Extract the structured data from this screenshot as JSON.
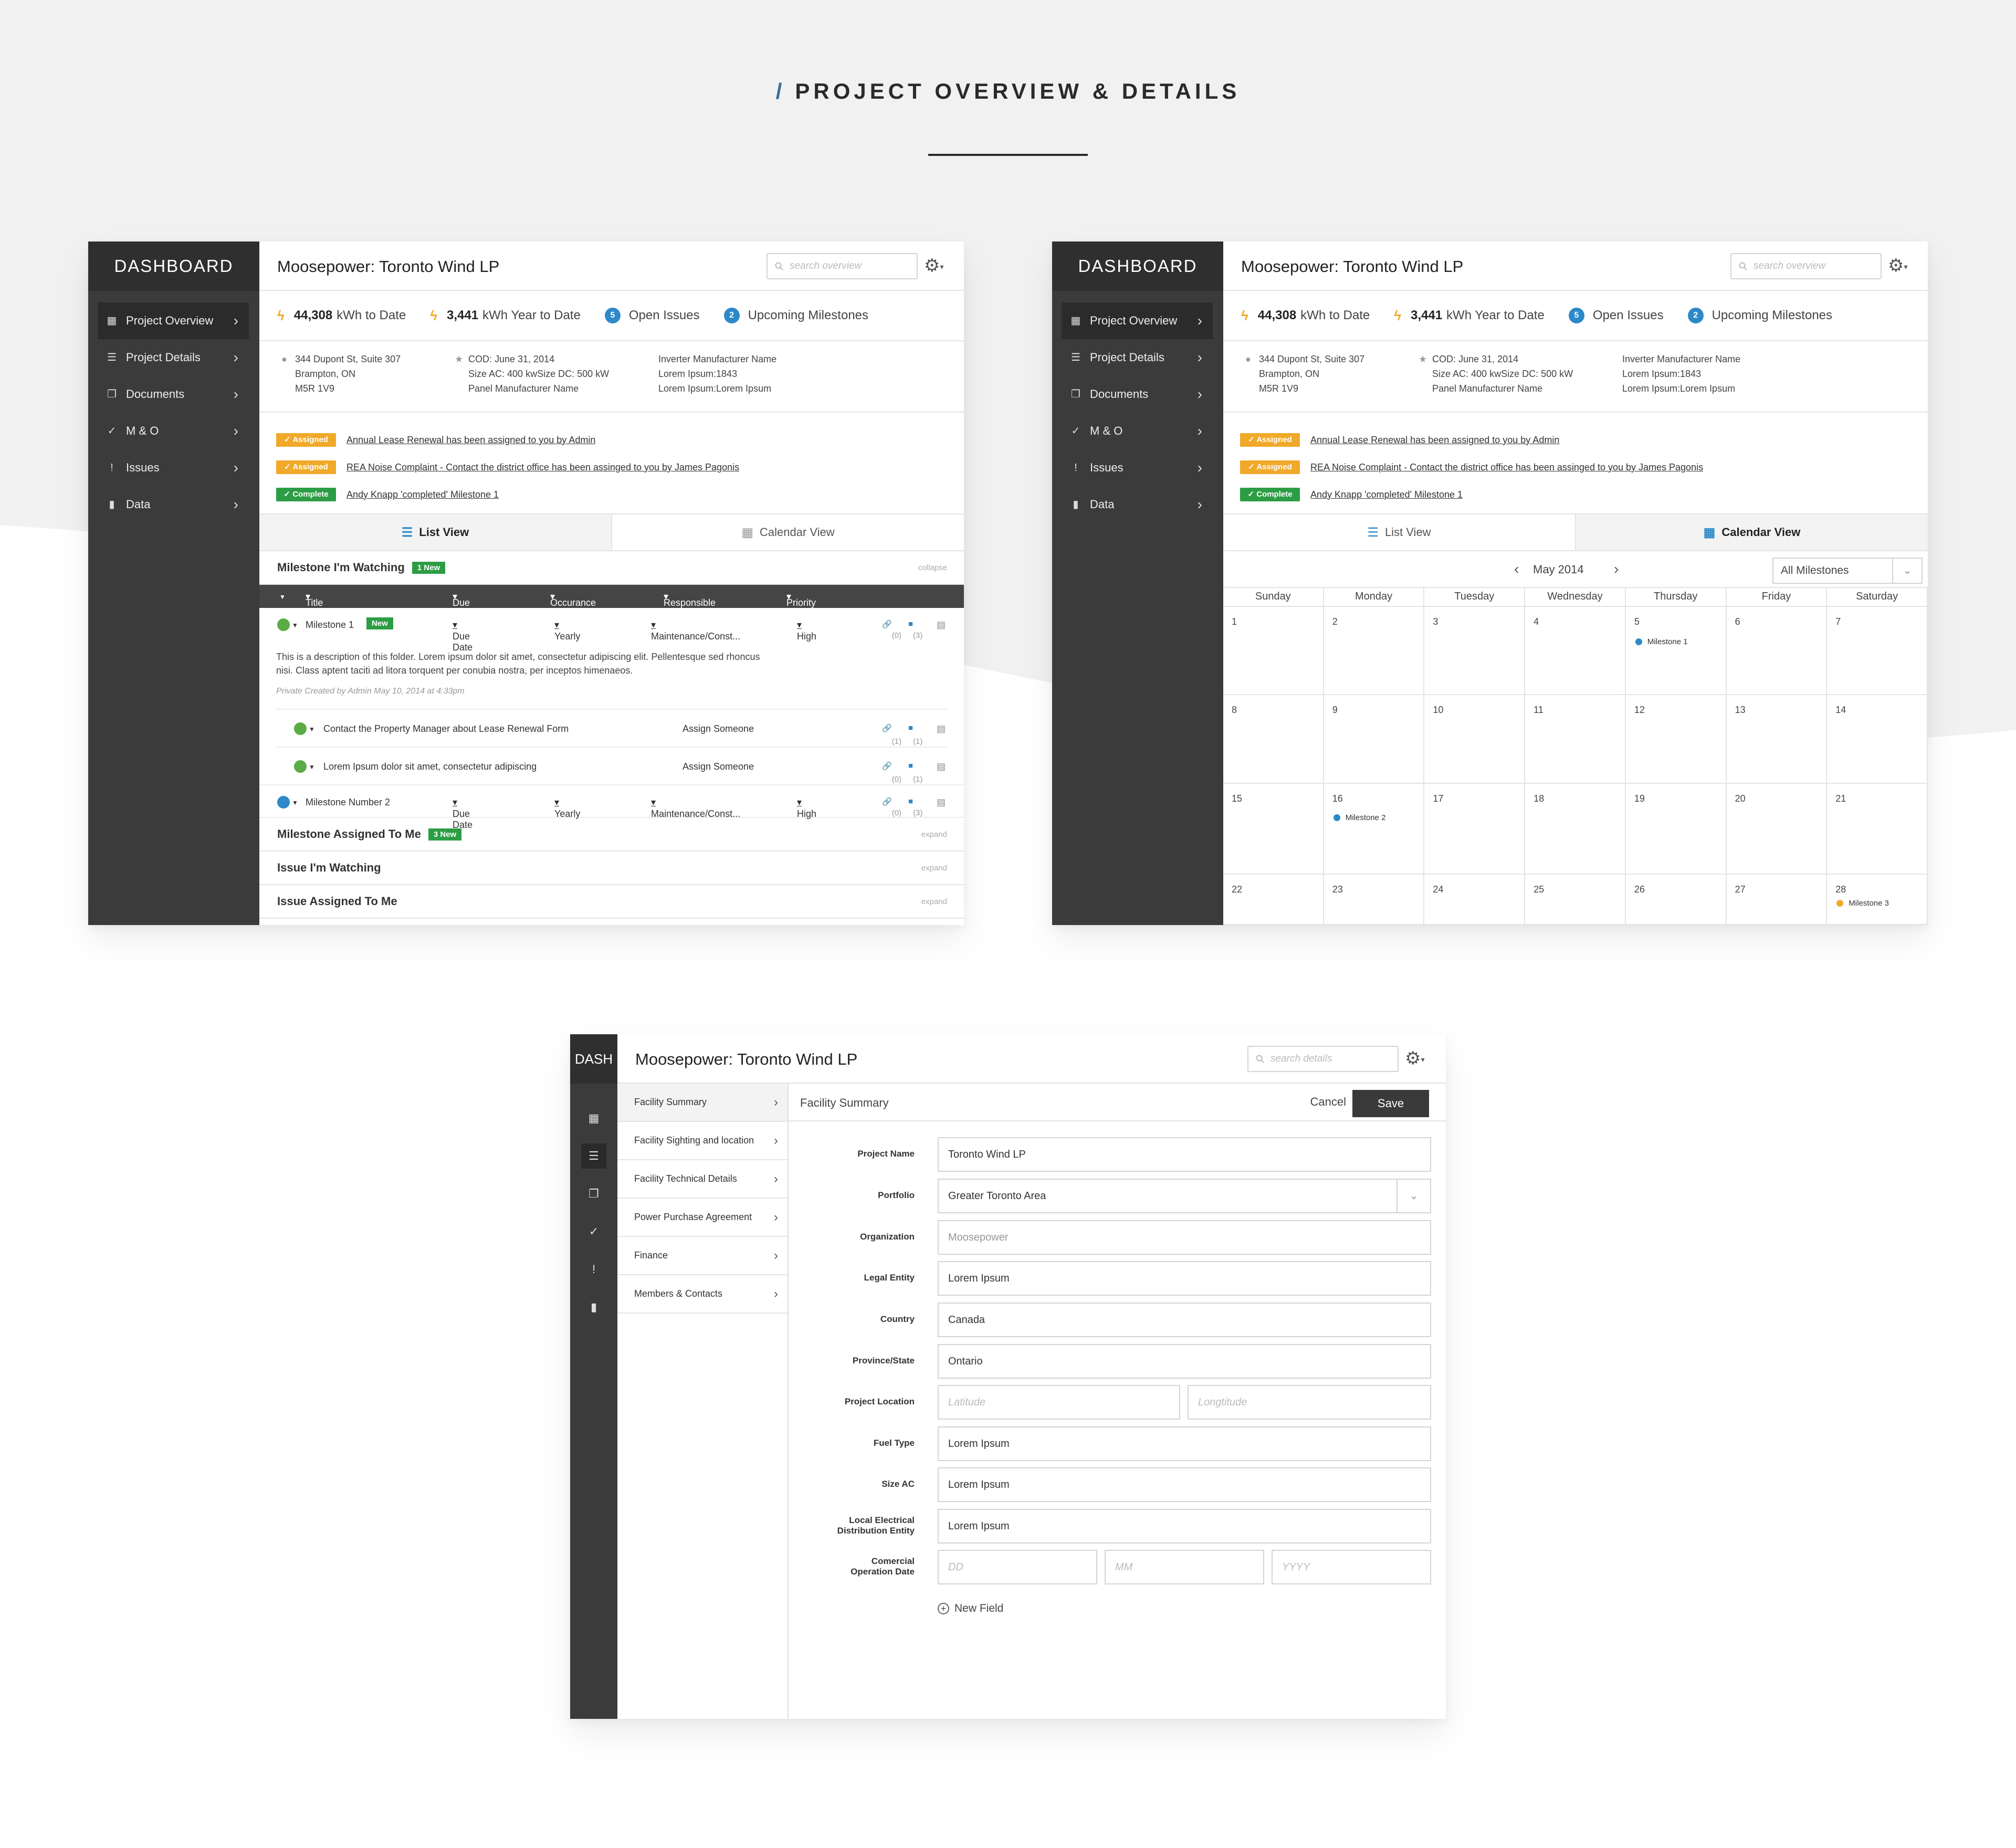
{
  "page": {
    "slash": "/",
    "title": "PROJECT OVERVIEW & DETAILS"
  },
  "brand": "DASHBOARD",
  "brand_short": "DASH",
  "project_title": "Moosepower: Toronto Wind LP",
  "search_overview": "search overview",
  "search_details": "search details",
  "nav": [
    {
      "label": "Project Overview",
      "icon": "grid-icon"
    },
    {
      "label": "Project Details",
      "icon": "list-icon"
    },
    {
      "label": "Documents",
      "icon": "documents-icon"
    },
    {
      "label": "M & O",
      "icon": "check-circle-icon"
    },
    {
      "label": "Issues",
      "icon": "issue-icon"
    },
    {
      "label": "Data",
      "icon": "bar-chart-icon"
    }
  ],
  "stats": {
    "kwh_total": "44,308",
    "kwh_total_label": "kWh to Date",
    "kwh_year": "3,441",
    "kwh_year_label": "kWh Year to Date",
    "issues_count": "5",
    "issues_label": "Open Issues",
    "milestones_count": "2",
    "milestones_label": "Upcoming Milestones"
  },
  "info": {
    "address": [
      "344 Dupont St, Suite 307",
      "Brampton, ON",
      "M5R 1V9"
    ],
    "specs": [
      "COD: June 31, 2014",
      "Size AC: 400 kwSize DC: 500 kW",
      "Panel Manufacturer Name"
    ],
    "extra": [
      "Inverter Manufacturer Name",
      "Lorem Ipsum:1843",
      "Lorem Ipsum:Lorem Ipsum"
    ]
  },
  "activity": [
    {
      "badge": "Assigned",
      "text": "Annual Lease Renewal has been assigned to you by Admin"
    },
    {
      "badge": "Assigned",
      "text": "REA Noise Complaint - Contact the district office has been assinged to you by James Pagonis"
    },
    {
      "badge": "Complete",
      "text": "Andy Knapp 'completed' Milestone 1"
    }
  ],
  "tabs": {
    "list": "List View",
    "calendar": "Calendar View"
  },
  "list": {
    "section1": "Milestone I'm Watching",
    "section1_badge": "1 New",
    "collapse": "collapse",
    "columns": [
      "Title",
      "Due Date",
      "Occurance",
      "Responsible Party",
      "Priority"
    ],
    "row1": {
      "title": "Milestone 1",
      "badge": "New",
      "due": "Due Date",
      "occ": "Yearly",
      "party": "Maintenance/Const...",
      "priority": "High",
      "links": "(0)",
      "comments": "(3)"
    },
    "desc": "This is a description of this folder. Lorem ipsum dolor sit amet, consectetur adipiscing elit. Pellentesque sed rhoncus nisi. Class aptent taciti ad litora torquent per conubia nostra, per inceptos himenaeos.",
    "desc_meta": "Private    Created by Admin May 10, 2014 at 4:33pm",
    "sub1": {
      "title": "Contact the Property Manager about Lease Renewal Form",
      "assign": "Assign Someone",
      "links": "(1)",
      "comments": "(1)"
    },
    "sub2": {
      "title": "Lorem Ipsum dolor sit amet, consectetur adipiscing",
      "assign": "Assign Someone",
      "links": "(0)",
      "comments": "(1)"
    },
    "row2": {
      "title": "Milestone Number 2",
      "due": "Due Date",
      "occ": "Yearly",
      "party": "Maintenance/Const...",
      "priority": "High",
      "links": "(0)",
      "comments": "(3)"
    },
    "section2": "Milestone Assigned To Me",
    "section2_badge": "3 New",
    "section3": "Issue I'm Watching",
    "section4": "Issue Assigned To Me",
    "expand": "expand"
  },
  "calendar": {
    "month": "May 2014",
    "filter": "All Milestones",
    "days": [
      "Sunday",
      "Monday",
      "Tuesday",
      "Wednesday",
      "Thursday",
      "Friday",
      "Saturday"
    ],
    "events": [
      {
        "date": "5",
        "label": "Milestone 1",
        "color": "#2d89c8"
      },
      {
        "date": "16",
        "label": "Milestone 2",
        "color": "#2d89c8"
      },
      {
        "date": "28",
        "label": "Milestone 3",
        "color": "#f0a929"
      }
    ]
  },
  "details": {
    "nav": [
      "Facility Summary",
      "Facility Sighting and location",
      "Facility Technical Details",
      "Power Purchase Agreement",
      "Finance",
      "Members & Contacts"
    ],
    "heading": "Facility Summary",
    "cancel": "Cancel",
    "save": "Save",
    "fields": {
      "project_name": {
        "label": "Project Name",
        "value": "Toronto Wind LP"
      },
      "portfolio": {
        "label": "Portfolio",
        "value": "Greater Toronto Area"
      },
      "organization": {
        "label": "Organization",
        "placeholder": "Moosepower"
      },
      "legal_entity": {
        "label": "Legal Entity",
        "value": "Lorem Ipsum"
      },
      "country": {
        "label": "Country",
        "value": "Canada"
      },
      "province": {
        "label": "Province/State",
        "value": "Ontario"
      },
      "location": {
        "label": "Project Location",
        "lat": "Latitude",
        "lng": "Longtitude"
      },
      "fuel": {
        "label": "Fuel Type",
        "value": "Lorem Ipsum"
      },
      "size_ac": {
        "label": "Size AC",
        "value": "Lorem Ipsum"
      },
      "ldc": {
        "label1": "Local Electrical",
        "label2": "Distribution Entity",
        "value": "Lorem Ipsum"
      },
      "cod": {
        "label1": "Comercial",
        "label2": "Operation Date",
        "dd": "DD",
        "mm": "MM",
        "yyyy": "YYYY"
      }
    },
    "new_field": "New Field"
  },
  "colors": {
    "assigned": "#f0a929",
    "complete": "#2c9d44",
    "accent": "#2d89c8",
    "sidebar": "#3b3b3b",
    "green_dot": "#5aac44",
    "blue_dot": "#2d89c8"
  }
}
